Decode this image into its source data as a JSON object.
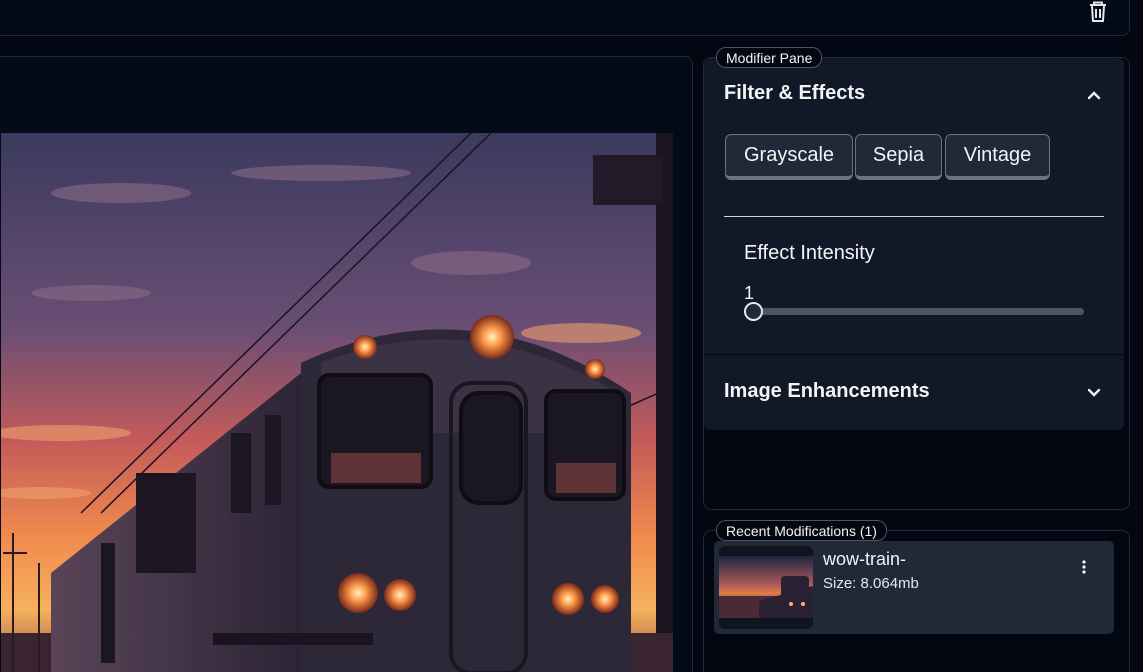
{
  "toolbar": {
    "delete_icon": "trash-icon"
  },
  "modifier_pane": {
    "label": "Modifier Pane",
    "filters_section": {
      "title": "Filter & Effects",
      "expanded": true,
      "buttons": [
        "Grayscale",
        "Sepia",
        "Vintage"
      ],
      "intensity_label": "Effect Intensity",
      "intensity_value": "1",
      "intensity_fraction": 0
    },
    "enhancements_section": {
      "title": "Image Enhancements",
      "expanded": false
    }
  },
  "recent": {
    "label": "Recent Modifications (1)",
    "items": [
      {
        "name": "wow-train-",
        "size": "Size: 8.064mb"
      }
    ]
  },
  "colors": {
    "background": "#030712",
    "panel": "#111827",
    "card": "#1f2937",
    "border": "#1f2937"
  }
}
